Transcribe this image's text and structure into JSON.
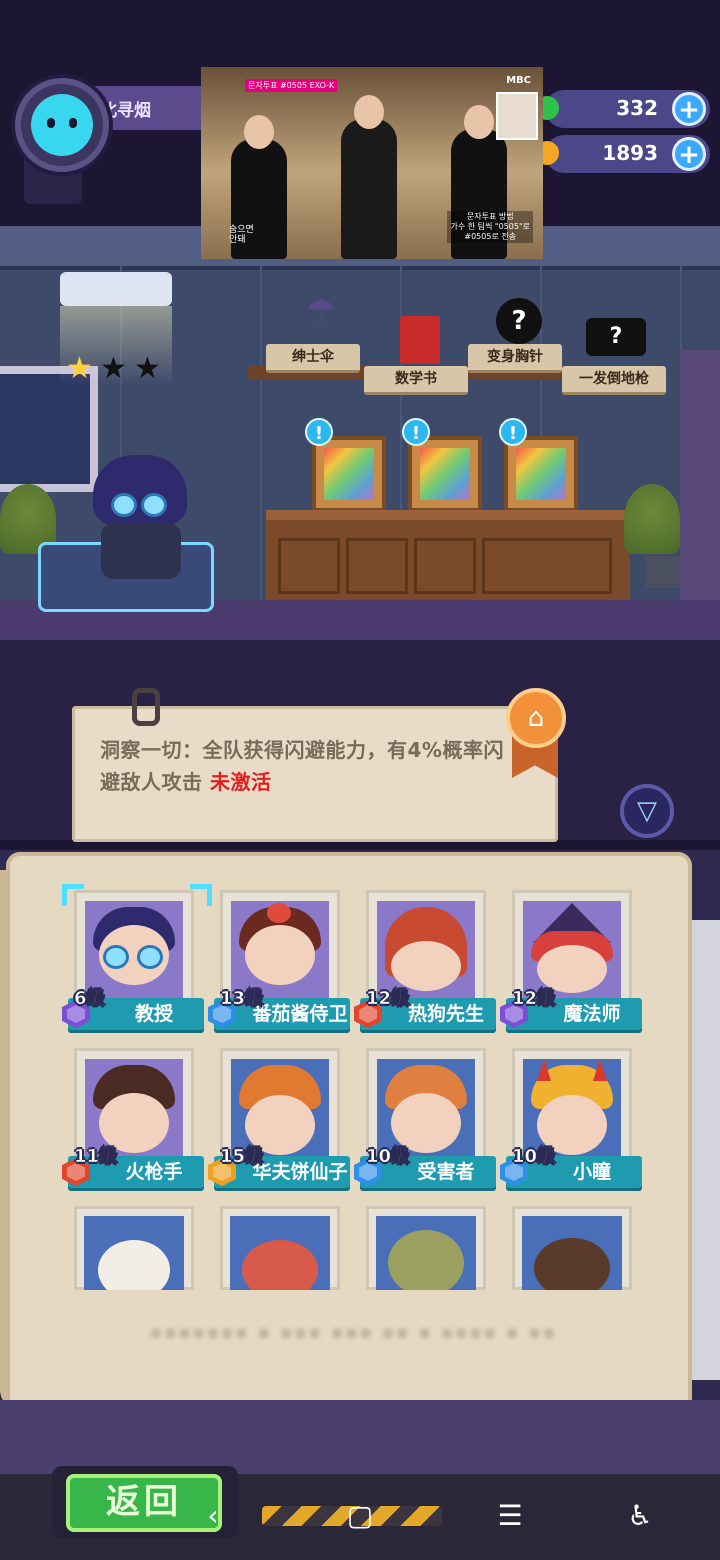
{
  "player": {
    "name": "北寻烟"
  },
  "currencies": [
    {
      "value": "332",
      "color": "#2fc24a"
    },
    {
      "value": "1893",
      "color": "#f5a623"
    }
  ],
  "video_overlay": {
    "top_tag": "문자투표 #0505 EXO-K",
    "watermark": "MBC",
    "caption_left": "숨으면\n안돼",
    "caption_right": "문자투표 방법\n가수 한 팀씩 \"0505\"로\n#0505로 전송"
  },
  "room": {
    "stars_filled": 1,
    "stars_total": 3,
    "shelf_items": [
      {
        "label": "绅士伞",
        "icon": "umbrella-icon"
      },
      {
        "label": "数学书",
        "icon": "math-book-icon"
      },
      {
        "label": "变身胸针",
        "icon": "mystery-pin-icon"
      },
      {
        "label": "一发倒地枪",
        "icon": "mystery-gun-icon"
      }
    ],
    "frames_alert_glyph": "!"
  },
  "info": {
    "description": "洞察一切：全队获得闪避能力，有4%概率闪避敌人攻击",
    "status": "未激活"
  },
  "characters": [
    {
      "level": "6级",
      "name": "教授",
      "badge_color": "#7a4fd6",
      "selected": true
    },
    {
      "level": "13级",
      "name": "番茄酱侍卫",
      "badge_color": "#2f8fe6",
      "selected": false
    },
    {
      "level": "12级",
      "name": "热狗先生",
      "badge_color": "#e0452e",
      "selected": false
    },
    {
      "level": "12级",
      "name": "魔法师",
      "badge_color": "#7a4fd6",
      "selected": false
    },
    {
      "level": "11级",
      "name": "火枪手",
      "badge_color": "#e0452e",
      "selected": false
    },
    {
      "level": "15级",
      "name": "华夫饼仙子",
      "badge_color": "#f0a020",
      "selected": false
    },
    {
      "level": "10级",
      "name": "受害者",
      "badge_color": "#2f8fe6",
      "selected": false
    },
    {
      "level": "10级",
      "name": "小瞳",
      "badge_color": "#2f8fe6",
      "selected": false
    }
  ],
  "bottom": {
    "back_label": "返回"
  },
  "system_nav": {
    "back": "‹",
    "home": "▢",
    "recents": "☰",
    "accessibility": "♿"
  }
}
